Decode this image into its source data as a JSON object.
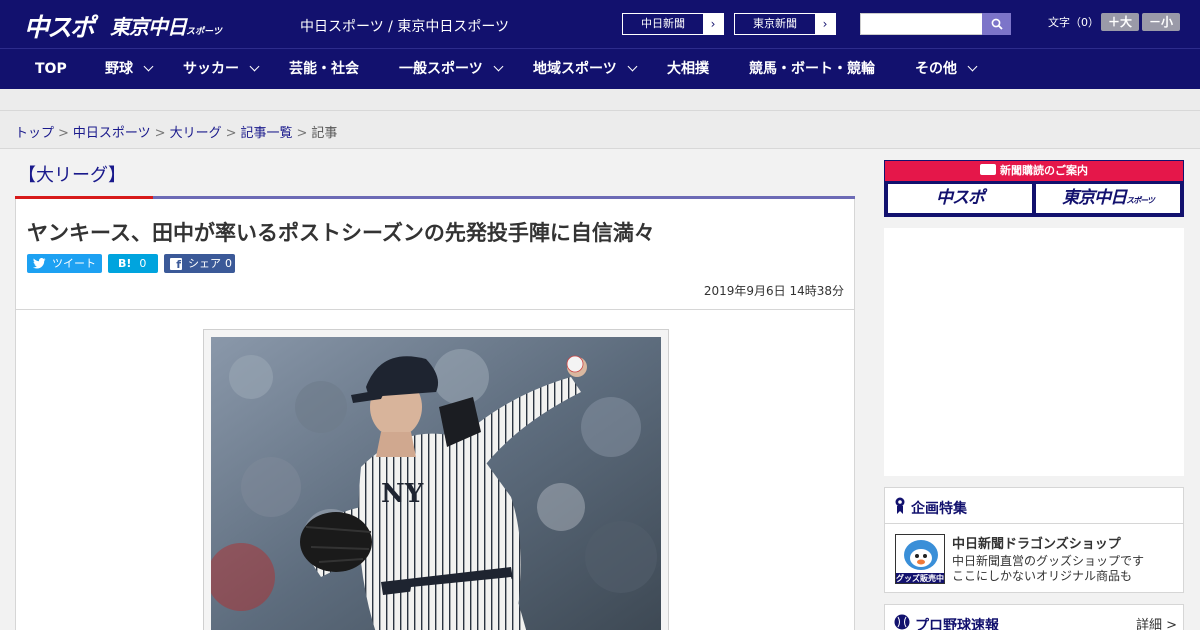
{
  "header": {
    "logo_chunichi": "中スポ",
    "logo_tokyo": "東京中日",
    "logo_tokyo_sub": "スポーツ",
    "site_names": "中日スポーツ / 東京中日スポーツ",
    "paper_buttons": [
      "中日新聞",
      "東京新聞"
    ],
    "fontsize_label": "文字（0）",
    "font_larger": "＋大",
    "font_smaller": "－小"
  },
  "nav": [
    "TOP",
    "野球",
    "サッカー",
    "芸能・社会",
    "一般スポーツ",
    "地域スポーツ",
    "大相撲",
    "競馬・ボート・競輪",
    "その他"
  ],
  "breadcrumb": {
    "links": [
      "トップ",
      "中日スポーツ",
      "大リーグ",
      "記事一覧"
    ],
    "current": "記事",
    "separator": ">"
  },
  "article": {
    "category": "【大リーグ】",
    "headline": "ヤンキース、田中が率いるポストシーズンの先発投手陣に自信満々",
    "share": {
      "tweet": "ツイート",
      "hatena_mark": "B!",
      "hatena_count": "0",
      "facebook": "シェア",
      "facebook_count": "0"
    },
    "date": "2019年9月6日 14時38分"
  },
  "sidebar": {
    "subscribe_title": "新聞購読のご案内",
    "subscribe_logos": [
      "中スポ",
      "東京中日"
    ],
    "subscribe_logo_sub": "スポーツ",
    "feature_title": "企画特集",
    "shop_title": "中日新聞ドラゴンズショップ",
    "shop_desc_1": "中日新聞直営のグッズショップです",
    "shop_desc_2": "ここにしかないオリジナル商品も",
    "shop_badge": "グッズ販売中",
    "baseball_title": "プロ野球速報",
    "baseball_detail": "詳細 >"
  },
  "colors": {
    "header_navy": "#12116e",
    "accent_red": "#d71a1a",
    "accent_purple": "#6d6bb6",
    "twitter": "#1da1f2",
    "hatena": "#00a4de",
    "facebook": "#3b5998"
  }
}
